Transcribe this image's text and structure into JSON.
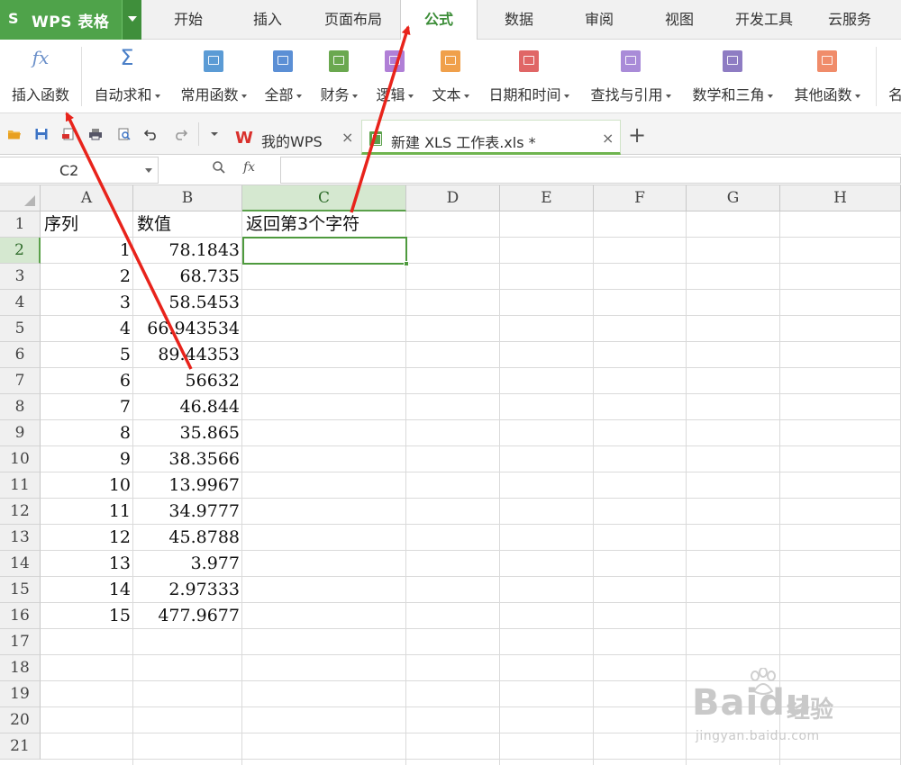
{
  "app": {
    "title": "WPS 表格",
    "logo_glyph": "S"
  },
  "menu_tabs": [
    {
      "label": "开始",
      "active": false
    },
    {
      "label": "插入",
      "active": false
    },
    {
      "label": "页面布局",
      "active": false
    },
    {
      "label": "公式",
      "active": true
    },
    {
      "label": "数据",
      "active": false
    },
    {
      "label": "审阅",
      "active": false
    },
    {
      "label": "视图",
      "active": false
    },
    {
      "label": "开发工具",
      "active": false
    },
    {
      "label": "云服务",
      "active": false
    }
  ],
  "ribbon": {
    "insert_function": {
      "label": "插入函数",
      "icon": "fx"
    },
    "autosum": {
      "label": "自动求和",
      "icon": "Σ"
    },
    "items": [
      {
        "label": "常用函数",
        "color": "#5b9bd5",
        "icon": "star-book-icon"
      },
      {
        "label": "全部",
        "color": "#5b8fd5",
        "icon": "list-book-icon"
      },
      {
        "label": "财务",
        "color": "#6aa84f",
        "icon": "finance-book-icon"
      },
      {
        "label": "逻辑",
        "color": "#b07fd6",
        "icon": "logic-book-icon"
      },
      {
        "label": "文本",
        "color": "#f0a04b",
        "icon": "text-book-icon"
      },
      {
        "label": "日期和时间",
        "color": "#e06666",
        "icon": "clock-book-icon"
      },
      {
        "label": "查找与引用",
        "color": "#a98bd8",
        "icon": "search-book-icon"
      },
      {
        "label": "数学和三角",
        "color": "#8e7cc3",
        "icon": "theta-book-icon"
      },
      {
        "label": "其他函数",
        "color": "#f08c6a",
        "icon": "more-book-icon"
      }
    ],
    "overflow_label": "名"
  },
  "doc_tabs": [
    {
      "name": "我的WPS",
      "close": "×",
      "logo": "W"
    },
    {
      "name": "新建 XLS 工作表.xls *",
      "close": "×"
    }
  ],
  "new_tab_glyph": "+",
  "formula_bar": {
    "name_box": "C2",
    "fx": "fx",
    "value": ""
  },
  "columns": [
    "A",
    "B",
    "C",
    "D",
    "E",
    "F",
    "G",
    "H"
  ],
  "selected_column": "C",
  "rows": [
    "1",
    "2",
    "3",
    "4",
    "5",
    "6",
    "7",
    "8",
    "9",
    "10",
    "11",
    "12",
    "13",
    "14",
    "15",
    "16",
    "17",
    "18",
    "19",
    "20",
    "21"
  ],
  "selected_row": "2",
  "sheet": {
    "headers": {
      "A": "序列",
      "B": "数值",
      "C": "返回第3个字符"
    },
    "data": [
      {
        "a": "1",
        "b": "78.1843"
      },
      {
        "a": "2",
        "b": "68.735"
      },
      {
        "a": "3",
        "b": "58.5453"
      },
      {
        "a": "4",
        "b": "66.943534"
      },
      {
        "a": "5",
        "b": "89.44353"
      },
      {
        "a": "6",
        "b": "56632"
      },
      {
        "a": "7",
        "b": "46.844"
      },
      {
        "a": "8",
        "b": "35.865"
      },
      {
        "a": "9",
        "b": "38.3566"
      },
      {
        "a": "10",
        "b": "13.9967"
      },
      {
        "a": "11",
        "b": "34.9777"
      },
      {
        "a": "12",
        "b": "45.8788"
      },
      {
        "a": "13",
        "b": "3.977"
      },
      {
        "a": "14",
        "b": "2.97333"
      },
      {
        "a": "15",
        "b": "477.9677"
      }
    ]
  },
  "colors": {
    "accent_green": "#4fa34a",
    "annotation_red": "#e8231b"
  },
  "watermark": {
    "brand": "Baidu",
    "brand_cn": "经验",
    "url": "jingyan.baidu.com"
  }
}
